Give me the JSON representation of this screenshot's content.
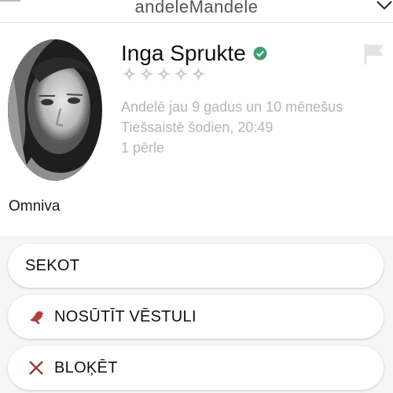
{
  "header": {
    "logo_text": "andeleMandele"
  },
  "profile": {
    "name": "Inga Sprukte",
    "verified": true,
    "rating_stars_total": 5,
    "rating_stars_filled": 0,
    "member_since": "Andelē jau 9 gadus un 10 mēnešus",
    "last_online": "Tiešsaistē šodien, 20:49",
    "pearls": "1 pērle",
    "company": "Omniva"
  },
  "actions": {
    "follow_label": "SEKOT",
    "message_label": "NOSŪTĪT VĒSTULI",
    "block_label": "BLOĶĒT"
  },
  "colors": {
    "accent_brand": "#c9a99b",
    "verified_badge": "#3f9e77",
    "meta_text": "#b6b6b6",
    "block_icon": "#9b3a34",
    "message_icon": "#b04040"
  }
}
